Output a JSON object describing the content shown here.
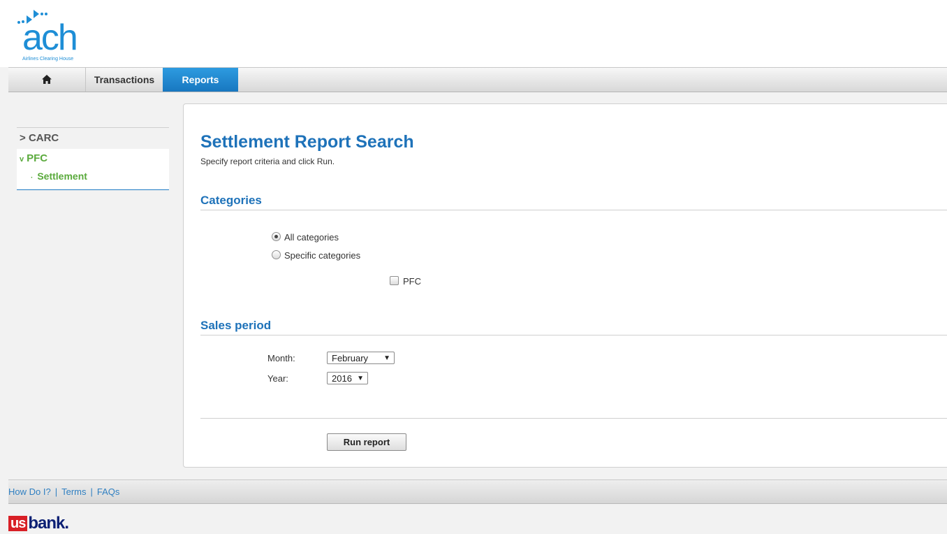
{
  "header": {
    "logo_text": "ach",
    "logo_subtitle": "Airlines Clearing House"
  },
  "nav": {
    "home_icon": "home-icon",
    "items": [
      {
        "label": "Transactions"
      },
      {
        "label": "Reports",
        "active": true
      }
    ]
  },
  "sidebar": {
    "items": [
      {
        "caret": ">",
        "label": "CARC"
      },
      {
        "caret": "v",
        "label": "PFC",
        "children": [
          {
            "bullet": "·",
            "label": "Settlement"
          }
        ]
      }
    ]
  },
  "main": {
    "title": "Settlement Report Search",
    "subtitle": "Specify report criteria and click Run.",
    "categories": {
      "heading": "Categories",
      "options": [
        {
          "label": "All categories",
          "checked": true
        },
        {
          "label": "Specific categories",
          "checked": false
        }
      ],
      "checkbox": {
        "label": "PFC",
        "checked": false
      }
    },
    "sales_period": {
      "heading": "Sales period",
      "month_label": "Month:",
      "month_value": "February",
      "year_label": "Year:",
      "year_value": "2016",
      "arrow": "▼"
    },
    "run_button": "Run report"
  },
  "footer": {
    "links": [
      "How Do I?",
      "Terms",
      "FAQs"
    ],
    "separator": "|"
  },
  "brand": {
    "us": "us",
    "bank": "bank."
  },
  "colors": {
    "accent": "#1e72b9",
    "nav_active": "#1e88d2",
    "sidebar_active": "#5aaa3c",
    "brand_red": "#d81f26",
    "brand_navy": "#0c2074"
  }
}
